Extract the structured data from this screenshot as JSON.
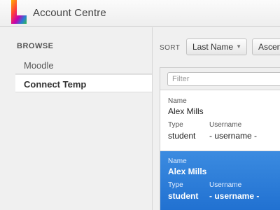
{
  "app": {
    "title": "Account Centre"
  },
  "sidebar": {
    "heading": "BROWSE",
    "items": [
      {
        "label": "Moodle",
        "selected": false
      },
      {
        "label": "Connect Temp",
        "selected": true
      }
    ]
  },
  "toolbar": {
    "sort_label": "SORT",
    "sort_field": "Last Name",
    "sort_order": "Ascend"
  },
  "filter": {
    "placeholder": "Filter",
    "value": ""
  },
  "records": [
    {
      "name_label": "Name",
      "name": "Alex Mills",
      "type_label": "Type",
      "type": "student",
      "username_label": "Username",
      "username": "- username -",
      "selected": false
    },
    {
      "name_label": "Name",
      "name": "Alex Mills",
      "type_label": "Type",
      "type": "student",
      "username_label": "Username",
      "username": "- username -",
      "selected": true
    }
  ],
  "colors": {
    "selection": "#2a7ad6",
    "brand": [
      "#ff9a00",
      "#ff3b3b",
      "#d000a0",
      "#2a7ad6",
      "#2fbf4a"
    ]
  }
}
